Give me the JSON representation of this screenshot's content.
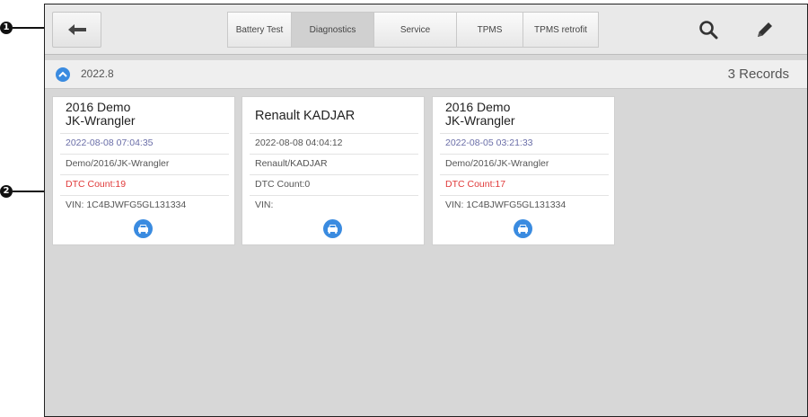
{
  "callouts": {
    "top": "1",
    "list": "2"
  },
  "toolbar": {
    "tabs": [
      {
        "label": "Battery Test",
        "active": false
      },
      {
        "label": "Diagnostics",
        "active": true
      },
      {
        "label": "Service",
        "active": false
      },
      {
        "label": "TPMS",
        "active": false
      },
      {
        "label": "TPMS retrofit",
        "active": false
      }
    ],
    "icons": {
      "back": "back-arrow-icon",
      "search": "search-icon",
      "edit": "edit-pencil-icon"
    }
  },
  "group": {
    "date": "2022.8",
    "records": "3 Records"
  },
  "cards": [
    {
      "title_line1": "2016 Demo",
      "title_line2": "JK-Wrangler",
      "date": "2022-08-08 07:04:35",
      "path": "Demo/2016/JK-Wrangler",
      "dtc": "DTC Count:19",
      "vin": "VIN: 1C4BJWFG5GL131334"
    },
    {
      "title_line1": "Renault KADJAR",
      "title_line2": "",
      "date": "2022-08-08 04:04:12",
      "path": "Renault/KADJAR",
      "dtc": "DTC Count:0",
      "vin": "VIN:"
    },
    {
      "title_line1": "2016 Demo",
      "title_line2": "JK-Wrangler",
      "date": "2022-08-05 03:21:33",
      "path": "Demo/2016/JK-Wrangler",
      "dtc": "DTC Count:17",
      "vin": "VIN: 1C4BJWFG5GL131334"
    }
  ],
  "colors": {
    "accent": "#3a8be0",
    "dtc_alert": "#e03a3a",
    "date_text": "#6a6ea8"
  }
}
